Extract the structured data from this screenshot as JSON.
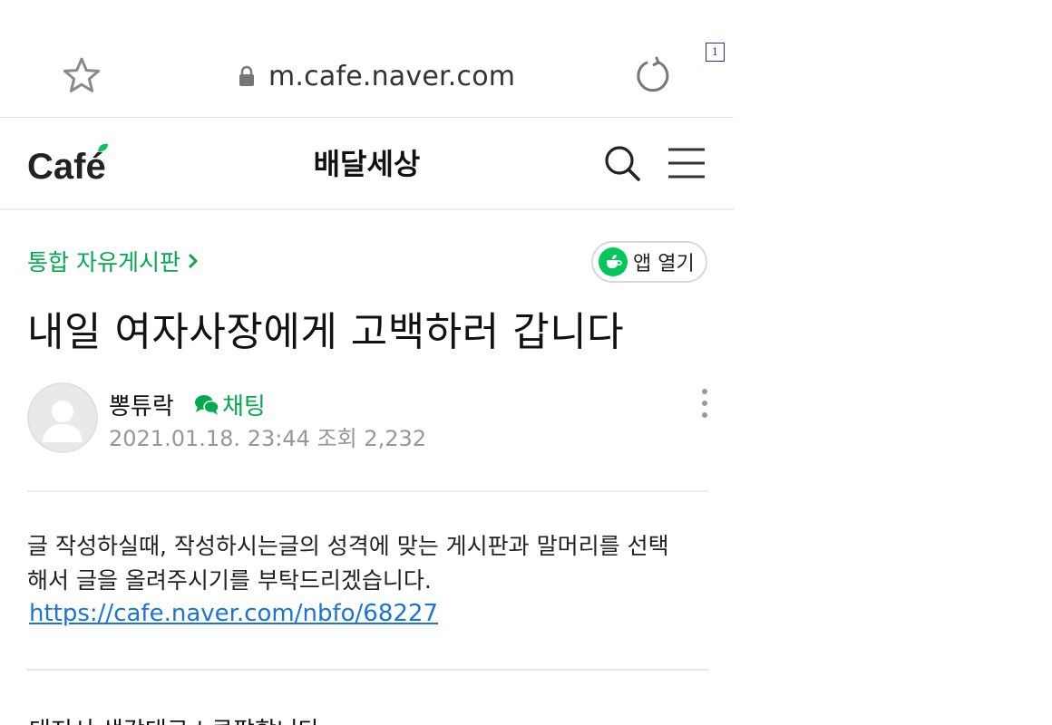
{
  "browser": {
    "url": "m.cafe.naver.com",
    "page_marker": "1"
  },
  "header": {
    "logo_text": "Café",
    "cafe_name": "배달세상"
  },
  "article": {
    "board_name": "통합 자유게시판",
    "app_open_label": "앱 열기",
    "title": "내일 여자사장에게 고백하러 갑니다",
    "author": "뽕튜락",
    "chat_label": "채팅",
    "date": "2021.01.18. 23:44",
    "views_label": "조회",
    "views": "2,232",
    "notice_line1": "글 작성하실때, 작성하시는글의 성격에 맞는 게시판과 말머리를 선택",
    "notice_line2": "해서 글을 올려주시기를 부탁드리겠습니다.",
    "notice_link": "https://cafe.naver.com/nbfo/68227",
    "body_start": "대저서 생각대로 | 큰팔합니다"
  },
  "colors": {
    "brand_green": "#03c75a",
    "board_green": "#03a94f",
    "link_blue": "#1a74d8",
    "meta_gray": "#979797"
  },
  "icons": [
    "star-icon",
    "lock-icon",
    "reload-icon",
    "cafe-logo-leaf-icon",
    "search-icon",
    "menu-icon",
    "chevron-right-icon",
    "cafe-app-icon",
    "avatar-placeholder-icon",
    "chat-bubble-icon",
    "more-vertical-icon"
  ]
}
